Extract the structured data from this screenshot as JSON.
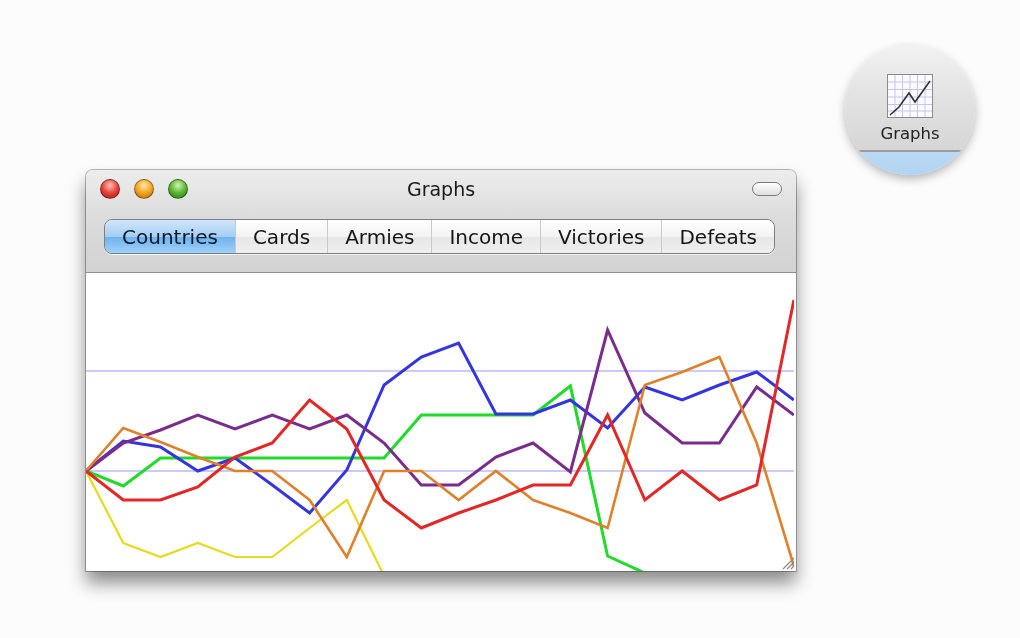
{
  "window": {
    "title": "Graphs"
  },
  "tabs": [
    {
      "label": "Countries",
      "selected": true
    },
    {
      "label": "Cards",
      "selected": false
    },
    {
      "label": "Armies",
      "selected": false
    },
    {
      "label": "Income",
      "selected": false
    },
    {
      "label": "Victories",
      "selected": false
    },
    {
      "label": "Defeats",
      "selected": false
    }
  ],
  "toolbar_item": {
    "label": "Graphs"
  }
}
